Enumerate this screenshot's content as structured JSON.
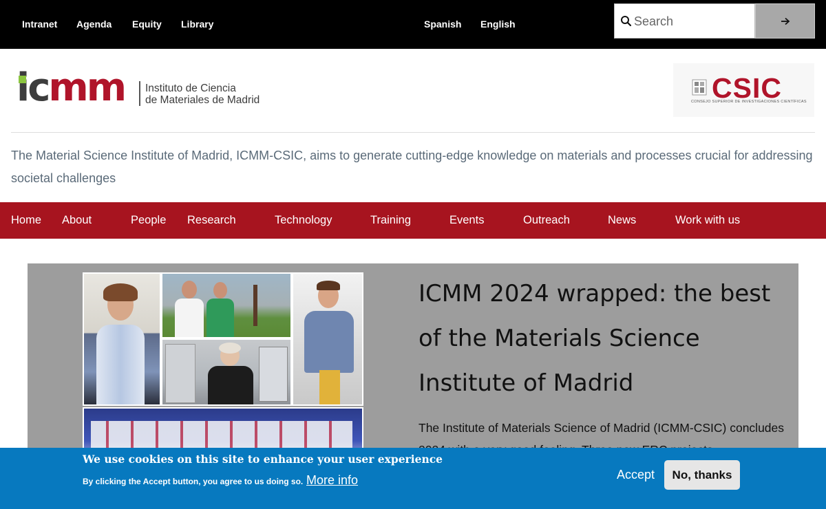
{
  "topbar": {
    "links": [
      "Intranet",
      "Agenda",
      "Equity",
      "Library"
    ],
    "languages": [
      "Spanish",
      "English"
    ],
    "search": {
      "placeholder": "Search"
    }
  },
  "header": {
    "logo_text": "icmm",
    "logo_subtitle_line1": "Instituto de Ciencia",
    "logo_subtitle_line2": "de Materiales de Madrid",
    "csic_text": "CSIC",
    "csic_subtitle": "CONSEJO SUPERIOR DE INVESTIGACIONES CIENTÍFICAS",
    "tagline": "The Material Science Institute of Madrid, ICMM-CSIC, aims to generate cutting-edge knowledge on materials and processes crucial for addressing societal challenges"
  },
  "nav": {
    "items": [
      "Home",
      "About",
      "People",
      "Research",
      "Technology",
      "Training",
      "Events",
      "Outreach",
      "News",
      "Work with us"
    ]
  },
  "hero": {
    "title": "ICMM 2024 wrapped: the best of the Materials Science Institute of Madrid",
    "text": "The Institute of Materials Science of Madrid (ICMM-CSIC) concludes 2024 with a very good feeling. Three new ERC projects"
  },
  "cookie": {
    "title": "We use cookies on this site to enhance your user experience",
    "desc": "By clicking the Accept button, you agree to us doing so.",
    "more": "More info",
    "accept": "Accept",
    "decline": "No, thanks"
  },
  "colors": {
    "brand_red": "#a7141f",
    "cookie_blue": "#0779bf",
    "logo_green": "#8bc53f"
  }
}
